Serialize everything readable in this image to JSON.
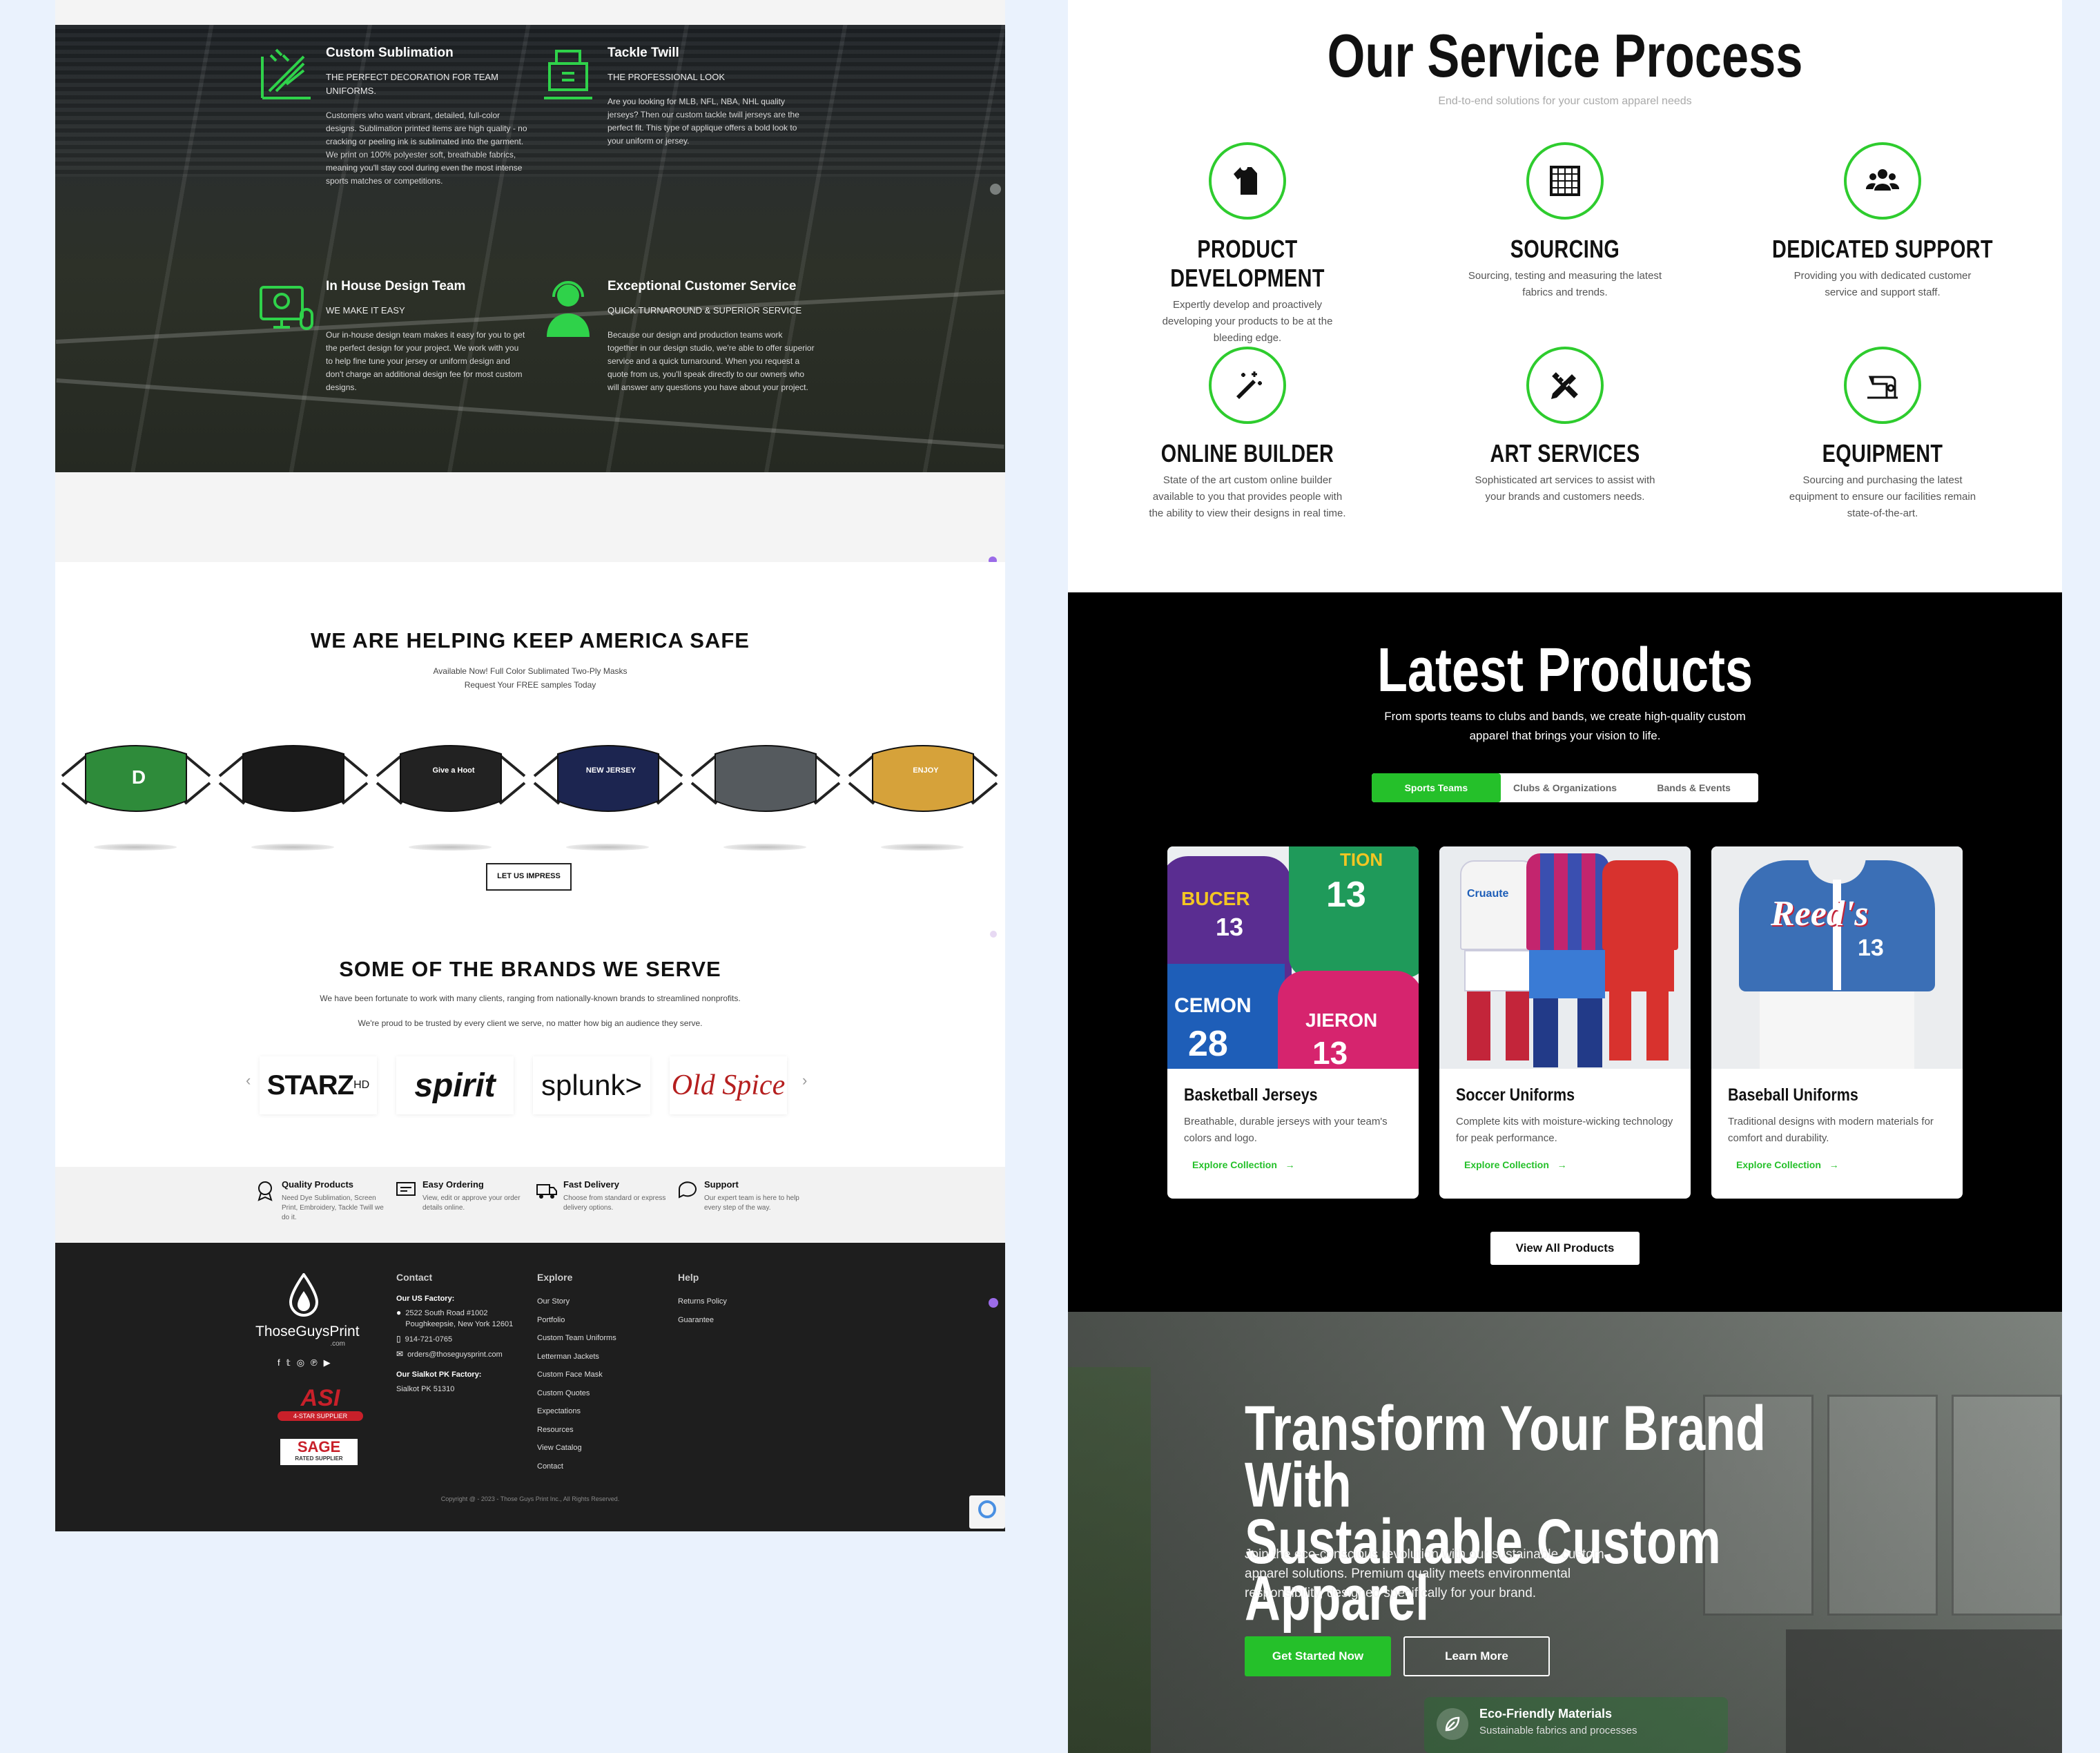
{
  "left": {
    "features": [
      {
        "icon": "sublimation-icon",
        "title": "Custom Sublimation",
        "subtitle": "THE PERFECT DECORATION FOR TEAM UNIFORMS.",
        "text": "Customers who want vibrant, detailed, full-color designs. Sublimation printed items are high quality - no cracking or peeling ink is sublimated into the garment. We print on 100% polyester soft, breathable fabrics, meaning you'll stay cool during even the most intense sports matches or competitions."
      },
      {
        "icon": "tackle-twill-icon",
        "title": "Tackle Twill",
        "subtitle": "THE PROFESSIONAL LOOK",
        "text": "Are you looking for MLB, NFL, NBA, NHL quality jerseys? Then our custom tackle twill jerseys are the perfect fit. This type of applique offers a bold look to your uniform or jersey."
      },
      {
        "icon": "design-team-icon",
        "title": "In House Design Team",
        "subtitle": "WE MAKE IT EASY",
        "text": "Our in-house design team makes it easy for you to get the perfect design for your project. We work with you to help fine tune your jersey or uniform design and don't charge an additional design fee for most custom designs."
      },
      {
        "icon": "customer-service-icon",
        "title": "Exceptional Customer Service",
        "subtitle": "QUICK TURNAROUND & SUPERIOR SERVICE",
        "text": "Because our design and production teams work together in our design studio, we're able to offer superior service and a quick turnaround. When you request a quote from us, you'll speak directly to our owners who will answer any questions you have about your project."
      }
    ],
    "masks_section": {
      "title": "WE ARE HELPING KEEP AMERICA SAFE",
      "line1": "Available Now! Full Color Sublimated Two-Ply Masks",
      "line2": "Request Your FREE samples Today",
      "button": "LET US IMPRESS"
    },
    "masks": [
      {
        "color": "#2e8b3a",
        "text": "D"
      },
      {
        "color": "#1a1a1a",
        "text": ""
      },
      {
        "color": "#222222",
        "text": "Give a Hoot"
      },
      {
        "color": "#1c2550",
        "text": "NEW JERSEY"
      },
      {
        "color": "#555a5e",
        "text": ""
      },
      {
        "color": "#d6a23a",
        "text": "ENJOY"
      }
    ],
    "brands_section": {
      "title": "SOME OF THE BRANDS WE SERVE",
      "line1": "We have been fortunate to work with many clients, ranging from nationally-known brands to streamlined nonprofits.",
      "line2": "We're proud to be trusted by every client we serve, no matter how big an audience they serve.",
      "brands": [
        "STARZ",
        "spirit",
        "splunk>",
        "Old Spice"
      ],
      "brand_sup": "HD",
      "prev": "‹",
      "next": "›"
    },
    "perks": [
      {
        "icon": "quality-icon",
        "title": "Quality Products",
        "text": "Need Dye Sublimation, Screen Print, Embroidery, Tackle Twill we do it."
      },
      {
        "icon": "ordering-icon",
        "title": "Easy Ordering",
        "text": "View, edit or approve your order details online."
      },
      {
        "icon": "delivery-icon",
        "title": "Fast Delivery",
        "text": "Choose from standard or express delivery options."
      },
      {
        "icon": "support-icon",
        "title": "Support",
        "text": "Our expert team is here to help every step of the way."
      }
    ],
    "footer": {
      "logo_text": "ThoseGuysPrint",
      "logo_sub": ".com",
      "badge1": "ASI",
      "badge1_sub": "4-STAR SUPPLIER",
      "badge2": "SAGE",
      "badge2_sub": "RATED SUPPLIER",
      "contact_heading": "Contact",
      "us_factory_label": "Our US Factory:",
      "address": "2522 South Road #1002 Poughkeepsie, New York 12601",
      "phone": "914-721-0765",
      "email": "orders@thoseguysprint.com",
      "pk_factory_label": "Our Sialkot PK Factory:",
      "pk_address": "Sialkot PK 51310",
      "explore_heading": "Explore",
      "explore_links": [
        "Our Story",
        "Portfolio",
        "Custom Team Uniforms",
        "Letterman Jackets",
        "Custom Face Mask",
        "Custom Quotes",
        "Expectations",
        "Resources",
        "View Catalog",
        "Contact"
      ],
      "help_heading": "Help",
      "help_links": [
        "Returns Policy",
        "Guarantee"
      ],
      "copyright": "Copyright @ - 2023 - Those Guys Print Inc., All Rights Reserved."
    }
  },
  "right": {
    "process": {
      "title": "Our Service Process",
      "subtitle": "End-to-end solutions for your custom apparel needs",
      "services": [
        {
          "icon": "shirt-icon",
          "title": "PRODUCT DEVELOPMENT",
          "text": "Expertly develop and proactively developing your products to be at the bleeding edge."
        },
        {
          "icon": "fabric-icon",
          "title": "SOURCING",
          "text": "Sourcing, testing and measuring the latest fabrics and trends."
        },
        {
          "icon": "team-icon",
          "title": "DEDICATED SUPPORT",
          "text": "Providing you with dedicated customer service and support staff."
        },
        {
          "icon": "magic-wand-icon",
          "title": "ONLINE BUILDER",
          "text": "State of the art custom online builder available to you that provides people with the ability to view their designs in real time."
        },
        {
          "icon": "pencil-ruler-icon",
          "title": "ART SERVICES",
          "text": "Sophisticated art services to assist with your brands and customers needs."
        },
        {
          "icon": "sewing-machine-icon",
          "title": "EQUIPMENT",
          "text": "Sourcing and purchasing the latest equipment to ensure our facilities remain state-of-the-art."
        }
      ]
    },
    "products": {
      "title": "Latest Products",
      "subtitle": "From sports teams to clubs and bands, we create high-quality custom apparel that brings your vision to life.",
      "tabs": [
        "Sports Teams",
        "Clubs & Organizations",
        "Bands & Events"
      ],
      "cards": [
        {
          "title": "Basketball Jerseys",
          "text": "Breathable, durable jerseys with your team's colors and logo.",
          "link": "Explore Collection",
          "arrow": "→"
        },
        {
          "title": "Soccer Uniforms",
          "text": "Complete kits with moisture-wicking technology for peak performance.",
          "link": "Explore Collection",
          "arrow": "→"
        },
        {
          "title": "Baseball Uniforms",
          "text": "Traditional designs with modern materials for comfort and durability.",
          "link": "Explore Collection",
          "arrow": "→"
        }
      ],
      "jersey_text": {
        "bucer": "BUCER",
        "tion": "TION",
        "cemon": "CEMON",
        "jieron": "JIERON",
        "n13": "13",
        "n28": "28",
        "brand": "Cruaute",
        "reeds": "Reed's"
      },
      "view_all": "View All Products"
    },
    "hero": {
      "title_line1": "Transform Your Brand With",
      "title_line2": "Sustainable Custom Apparel",
      "text": "Join the eco-conscious revolution with our sustainable custom apparel solutions. Premium quality meets environmental responsibility, designed specifically for your brand.",
      "btn_primary": "Get Started Now",
      "btn_secondary": "Learn More",
      "badge_title": "Eco-Friendly Materials",
      "badge_text": "Sustainable fabrics and processes"
    }
  }
}
